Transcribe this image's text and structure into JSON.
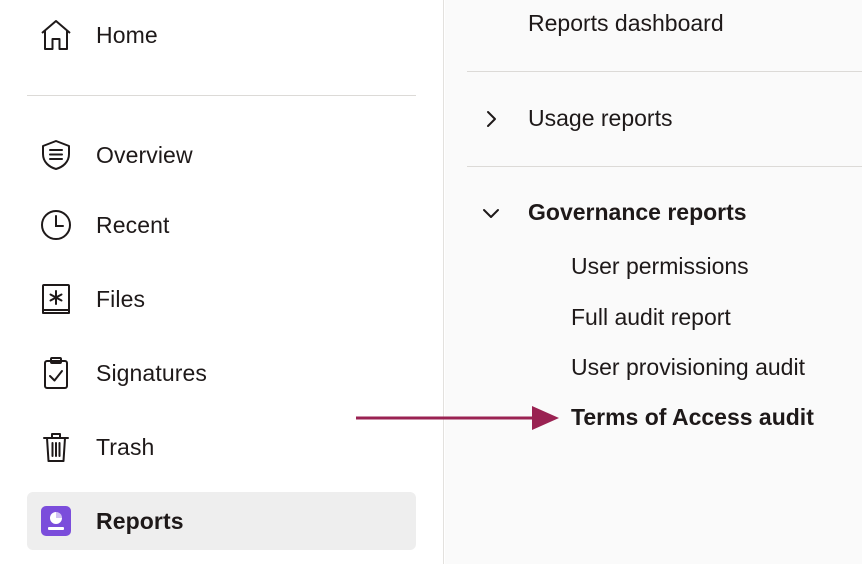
{
  "sidebar": {
    "items": [
      {
        "label": "Home",
        "icon": "home-icon"
      },
      {
        "label": "Overview",
        "icon": "shield-list-icon"
      },
      {
        "label": "Recent",
        "icon": "clock-icon"
      },
      {
        "label": "Files",
        "icon": "files-icon"
      },
      {
        "label": "Signatures",
        "icon": "clipboard-check-icon"
      },
      {
        "label": "Trash",
        "icon": "trash-icon"
      },
      {
        "label": "Reports",
        "icon": "reports-icon",
        "active": true
      }
    ]
  },
  "reports_panel": {
    "dashboard_label": "Reports dashboard",
    "usage_label": "Usage reports",
    "governance_label": "Governance reports",
    "governance_items": [
      {
        "label": "User permissions"
      },
      {
        "label": "Full audit report"
      },
      {
        "label": "User provisioning audit"
      },
      {
        "label": "Terms of Access audit",
        "highlighted": true
      }
    ]
  },
  "colors": {
    "reports_icon_bg": "#7b4ddb",
    "arrow": "#9a2252",
    "active_bg": "#eeeeee",
    "panel_bg": "#fafafa"
  }
}
